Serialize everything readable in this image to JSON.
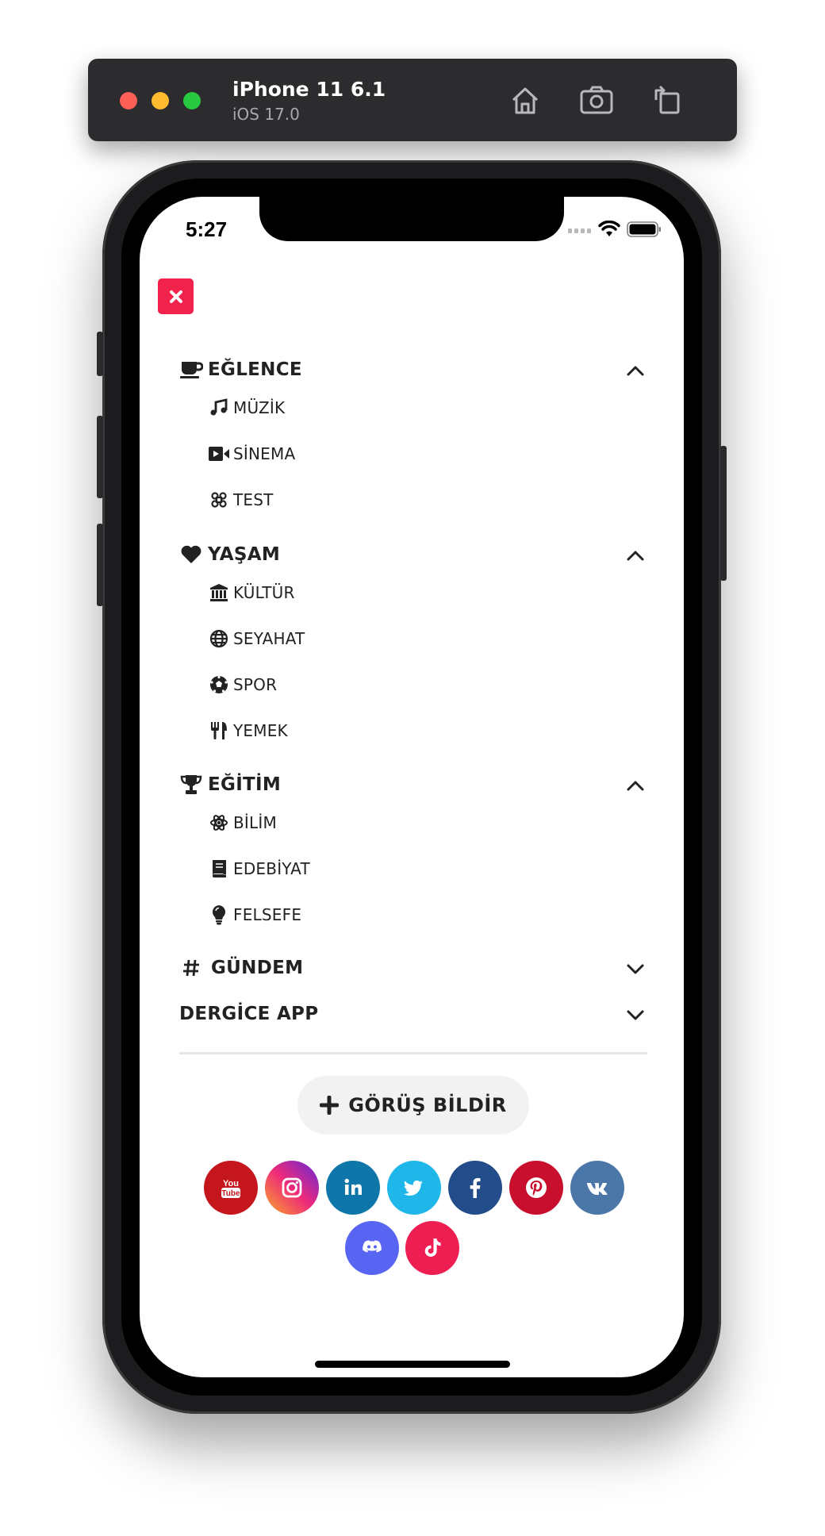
{
  "simulator": {
    "device_name": "iPhone 11 6.1",
    "os_version": "iOS 17.0",
    "buttons": [
      "home-icon",
      "screenshot-icon",
      "rotate-icon"
    ]
  },
  "status_bar": {
    "time": "5:27"
  },
  "menu": {
    "close_icon": "close-icon",
    "accent_color": "#f1234d",
    "sections": [
      {
        "label": "EĞLENCE",
        "icon": "coffee-icon",
        "expanded": true,
        "items": [
          {
            "label": "MÜZİK",
            "icon": "music-icon"
          },
          {
            "label": "SİNEMA",
            "icon": "video-icon"
          },
          {
            "label": "TEST",
            "icon": "command-icon"
          }
        ]
      },
      {
        "label": "YAŞAM",
        "icon": "heart-icon",
        "expanded": true,
        "items": [
          {
            "label": "KÜLTÜR",
            "icon": "landmark-icon"
          },
          {
            "label": "SEYAHAT",
            "icon": "globe-icon"
          },
          {
            "label": "SPOR",
            "icon": "football-icon"
          },
          {
            "label": "YEMEK",
            "icon": "utensils-icon"
          }
        ]
      },
      {
        "label": "EĞİTİM",
        "icon": "trophy-icon",
        "expanded": true,
        "items": [
          {
            "label": "BİLİM",
            "icon": "atom-icon"
          },
          {
            "label": "EDEBİYAT",
            "icon": "book-icon"
          },
          {
            "label": "FELSEFE",
            "icon": "lightbulb-icon"
          }
        ]
      },
      {
        "label": "GÜNDEM",
        "icon": "hashtag-icon",
        "expanded": false,
        "items": []
      },
      {
        "label": "DERGİCE APP",
        "icon": "",
        "expanded": false,
        "items": []
      }
    ]
  },
  "feedback_button": {
    "label": "GÖRÜŞ BİLDİR",
    "icon": "plus-icon"
  },
  "social_links": [
    {
      "name": "youtube-icon",
      "color": "#c4161c",
      "glyph": "You Tube"
    },
    {
      "name": "instagram-icon",
      "color": "#d6249f"
    },
    {
      "name": "linkedin-icon",
      "color": "#0e76a8",
      "glyph": "in"
    },
    {
      "name": "twitter-icon",
      "color": "#1fb7ea"
    },
    {
      "name": "facebook-icon",
      "color": "#234d8a",
      "glyph": "f"
    },
    {
      "name": "pinterest-icon",
      "color": "#c8102e"
    },
    {
      "name": "vk-icon",
      "color": "#4a76a8",
      "glyph": "vk"
    },
    {
      "name": "discord-icon",
      "color": "#5865f2"
    },
    {
      "name": "tiktok-icon",
      "color": "#ee1d52"
    }
  ]
}
